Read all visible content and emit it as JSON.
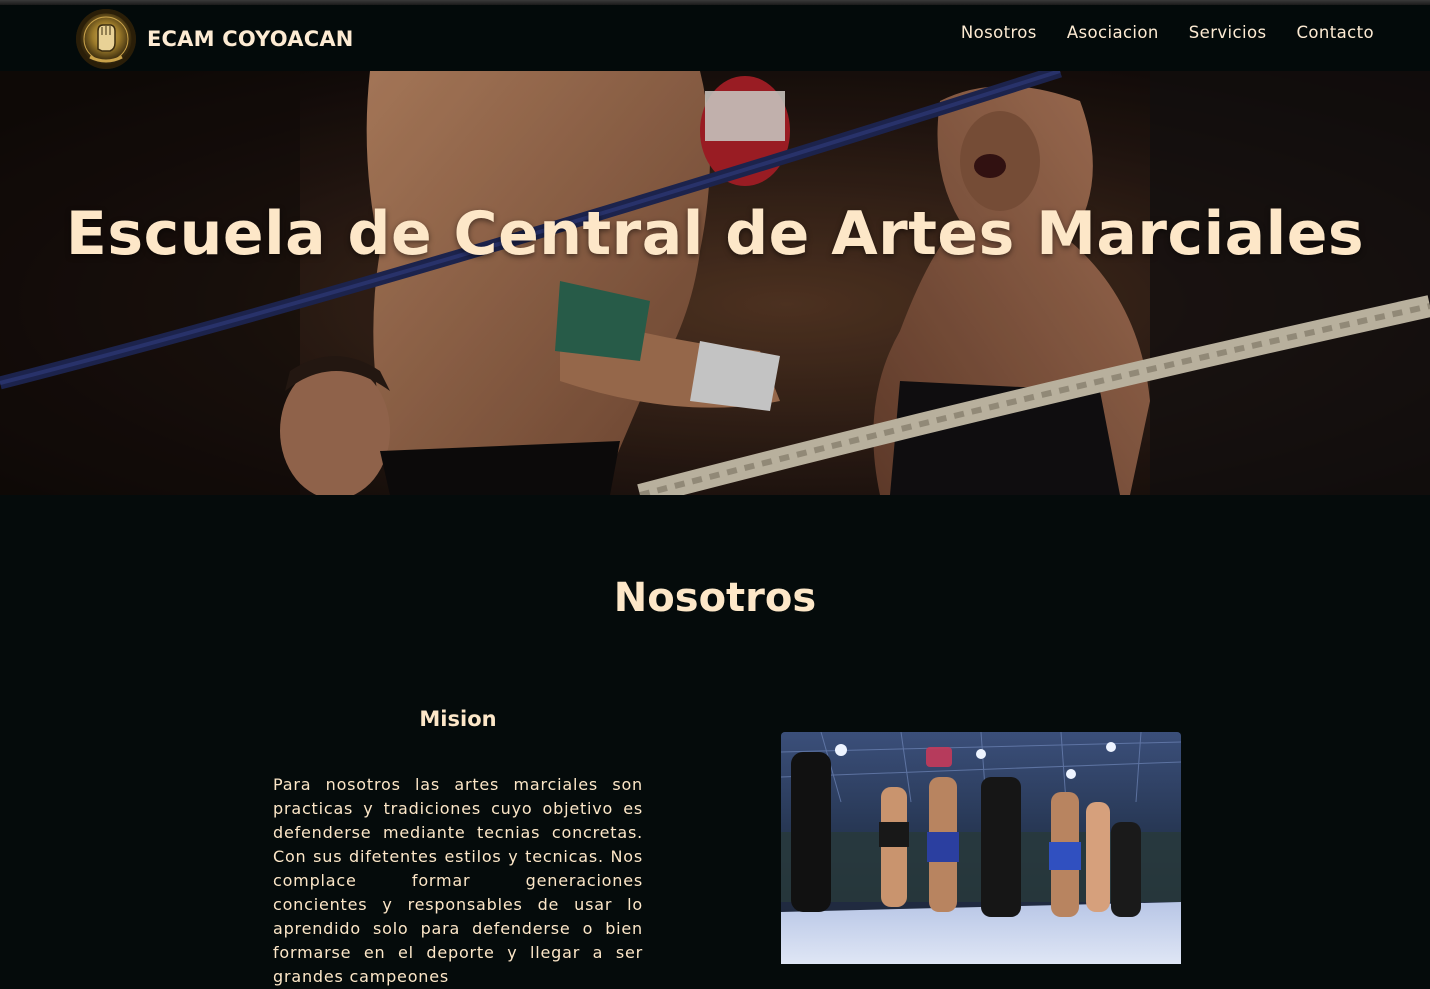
{
  "navbar": {
    "brand": "ECAM COYOACAN",
    "logo_icon": "muay-thai-fist-logo-icon",
    "links": [
      "Nosotros",
      "Asociacion",
      "Servicios",
      "Contacto"
    ]
  },
  "hero": {
    "title": "Escuela de Central de Artes Marciales",
    "image_icon": "kickboxing-ring-photo"
  },
  "nosotros": {
    "title": "Nosotros",
    "mision": {
      "heading": "Mision",
      "text": "Para nosotros las artes marciales son practicas y tradiciones cuyo objetivo es defenderse mediante tecnias concretas. Con sus difetentes estilos y tecnicas. Nos complace formar generaciones concientes y responsables de usar lo aprendido solo para defenderse o bien formarse en el deporte y llegar a ser grandes campeones"
    },
    "photo_icon": "fighters-in-ring-photo"
  },
  "colors": {
    "background": "#050b0b",
    "navbar": "#030a0a",
    "text": "#fde7c8"
  }
}
